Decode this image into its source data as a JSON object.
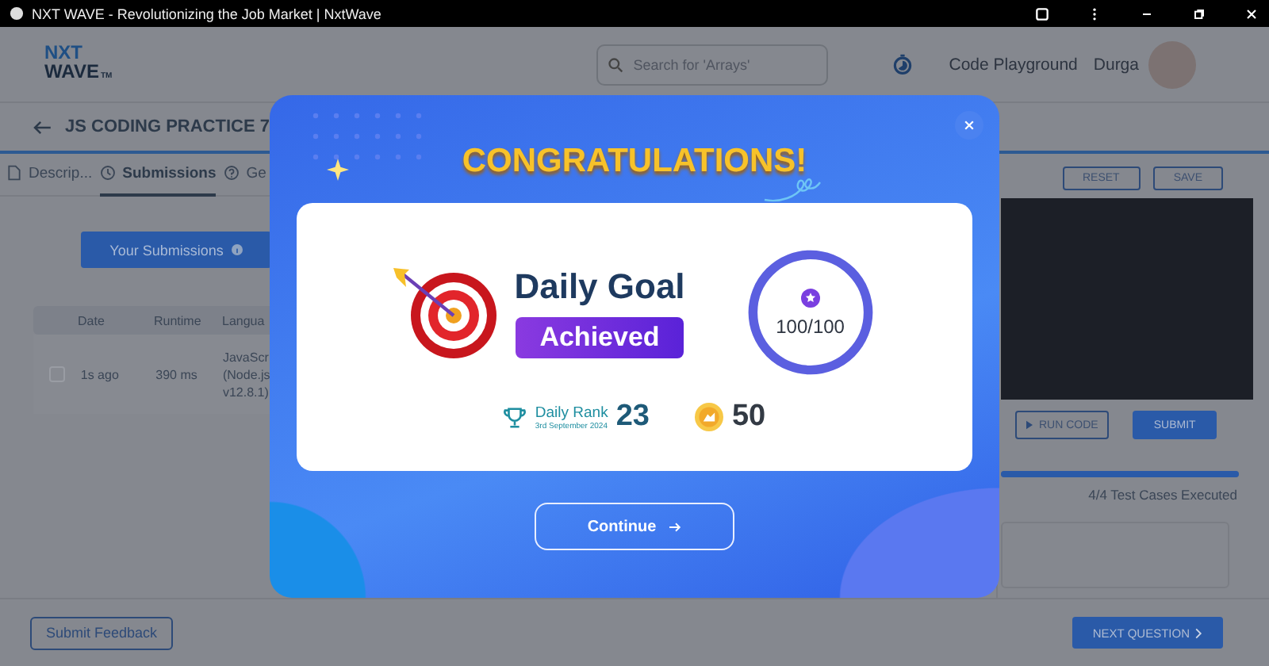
{
  "window": {
    "title": "NXT WAVE - Revolutionizing the Job Market | NxtWave"
  },
  "header": {
    "logo_line_1": "NXT",
    "logo_line_2": "WAVE",
    "logo_mark": "TM",
    "search": {
      "placeholder": "Search for 'Arrays'"
    },
    "link": "Code Playground",
    "user_name": "Durga"
  },
  "breadcrumb": {
    "title": "JS CODING PRACTICE 7"
  },
  "tabs": [
    {
      "label": "Descrip...",
      "selected": false
    },
    {
      "label": "Submissions",
      "selected": true
    },
    {
      "label": "Ge",
      "selected": false
    }
  ],
  "submissions": {
    "button": "Your Submissions",
    "columns": [
      "Date",
      "Runtime",
      "Langua"
    ],
    "rows": [
      {
        "checked": false,
        "cells": [
          "1s ago",
          "390 ms"
        ],
        "language": [
          "JavaScr",
          "(Node.js",
          "v12.8.1)"
        ]
      }
    ]
  },
  "feedback_button": "Submit Feedback",
  "editor": {
    "buttons": [
      "RESET",
      "SAVE"
    ],
    "run_button": "RUN CODE",
    "submit_button": "SUBMIT",
    "progress": {
      "level": 1
    },
    "result": "4/4 Test Cases Executed",
    "next_button": "NEXT QUESTION"
  },
  "modal": {
    "title": "CONGRATULATIONS!",
    "goal_title": "Daily Goal",
    "goal_status": "Achieved",
    "score": "100/100",
    "score_ring": {
      "level": 1
    },
    "rank_label": "Daily Rank",
    "rank_date": "3rd September 2024",
    "rank": "23",
    "coins": "50",
    "continue_button": "Continue"
  }
}
